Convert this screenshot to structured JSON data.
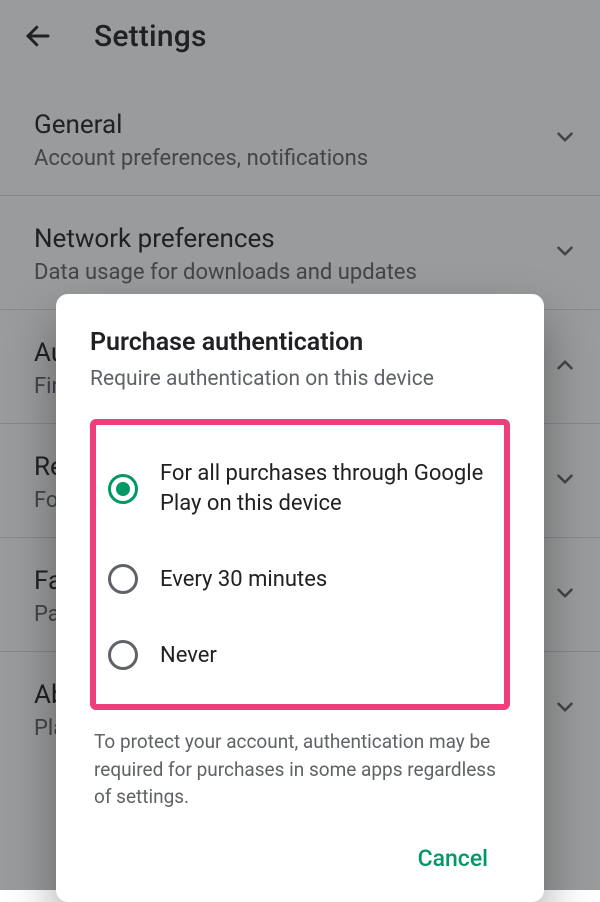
{
  "header": {
    "title": "Settings"
  },
  "list": [
    {
      "title": "General",
      "sub": "Account preferences, notifications",
      "chevron": "down"
    },
    {
      "title": "Network preferences",
      "sub": "Data usage for downloads and updates",
      "chevron": "down"
    },
    {
      "title": "Authentication",
      "sub": "Fingerprint",
      "chevron": "up"
    },
    {
      "title": "Require authentication",
      "sub": "For all purchases through Google Play on this device",
      "chevron": "down"
    },
    {
      "title": "Family",
      "sub": "Parental controls",
      "chevron": "down"
    },
    {
      "title": "About",
      "sub": "Play Store version",
      "chevron": "down"
    }
  ],
  "dialog": {
    "title": "Purchase authentication",
    "subtitle": "Require authentication on this device",
    "options": [
      {
        "label": "For all purchases through Google Play on this device",
        "selected": true
      },
      {
        "label": "Every 30 minutes",
        "selected": false
      },
      {
        "label": "Never",
        "selected": false
      }
    ],
    "note": "To protect your account, authentication may be required for purchases in some apps regardless of settings.",
    "cancel": "Cancel"
  },
  "colors": {
    "accent": "#009966",
    "highlight_border": "#ef3e7b"
  }
}
